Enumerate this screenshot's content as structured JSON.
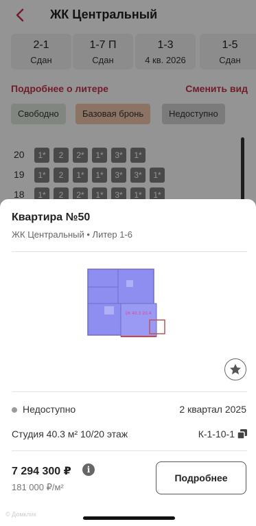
{
  "header": {
    "title": "ЖК Центральный"
  },
  "liters": [
    {
      "name": "2-1",
      "status": "Сдан"
    },
    {
      "name": "1-7 П",
      "status": "Сдан"
    },
    {
      "name": "1-3",
      "status": "4 кв. 2026"
    },
    {
      "name": "1-5",
      "status": "Сдан"
    }
  ],
  "links": {
    "more_about_liter": "Подробнее о литере",
    "change_view": "Сменить вид"
  },
  "legend": [
    {
      "label": "Свободно",
      "color": "#dfe9dc"
    },
    {
      "label": "Базовая бронь",
      "color": "#f2c6ab"
    },
    {
      "label": "Недоступно",
      "color": "#d4d4d4"
    }
  ],
  "floors": [
    {
      "number": "20",
      "cells": [
        "1*",
        "2",
        "2*",
        "1*",
        "3*",
        "1*"
      ]
    },
    {
      "number": "19",
      "cells": [
        "1*",
        "2",
        "1*",
        "1*",
        "3*",
        "3*",
        "1*"
      ]
    },
    {
      "number": "18",
      "cells": [
        "1*",
        "2",
        "2*",
        "1*",
        "3*",
        "1*",
        "1*"
      ]
    }
  ],
  "apartment": {
    "title": "Квартира №50",
    "subtitle": "ЖК Центральный • Литер 1-6",
    "plan_label": "1К 40.3 20.4",
    "status": "Недоступно",
    "deadline": "2 квартал 2025",
    "details": "Студия 40.3 м² 10/20 этаж",
    "code": "К-1-10-1",
    "price": "7 294 300 ₽",
    "price_per_m2": "181 000 ₽/м²",
    "more_button": "Подробнее"
  },
  "watermark": "© Домклик",
  "colors": {
    "accent": "#c4314b",
    "cell": "#7f7f7f",
    "plan_fill": "#8e8ef0",
    "plan_highlight": "#e0409a"
  }
}
